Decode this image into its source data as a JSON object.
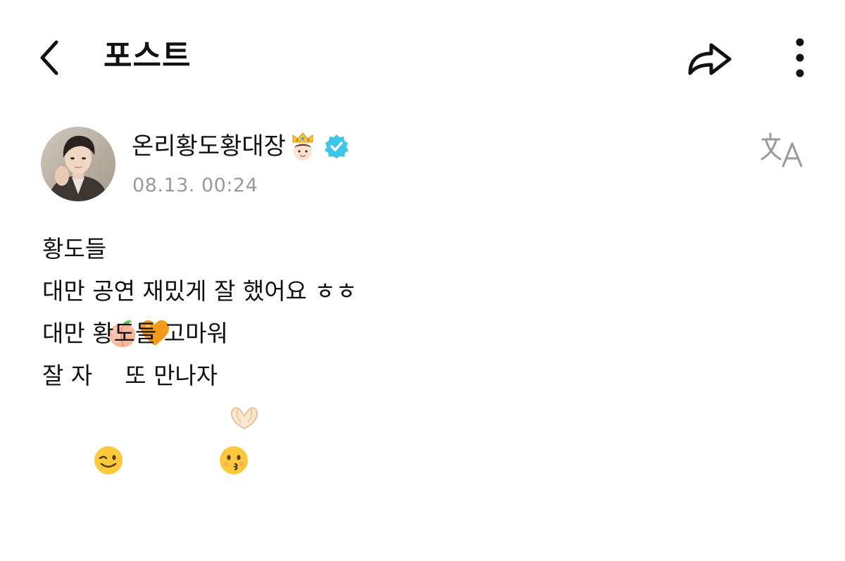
{
  "header": {
    "title": "포스트",
    "back_icon": "chevron-left-icon",
    "share_icon": "share-arrow-icon",
    "more_icon": "more-vertical-icon"
  },
  "author": {
    "name": "온리황도황대장",
    "name_icon": "crown-face-emoji",
    "verified_icon": "verified-badge-icon",
    "verified_color": "#3ec5e8",
    "timestamp": "08.13. 00:24"
  },
  "translate_icon": "translate-icon",
  "post": {
    "line1_text": "황도들",
    "line1_emojis": [
      "peach",
      "orange-heart"
    ],
    "line2_text": "대만 공연 재밌게 잘 했어요 ㅎㅎ",
    "line3_text": "대만 황도들 고마워",
    "line3_emoji": "heart-hands",
    "line4_text_a": "잘 자",
    "line4_emoji_a": "winking-face",
    "line4_text_b": "또 만나자",
    "line4_emoji_b": "kissing-face"
  }
}
